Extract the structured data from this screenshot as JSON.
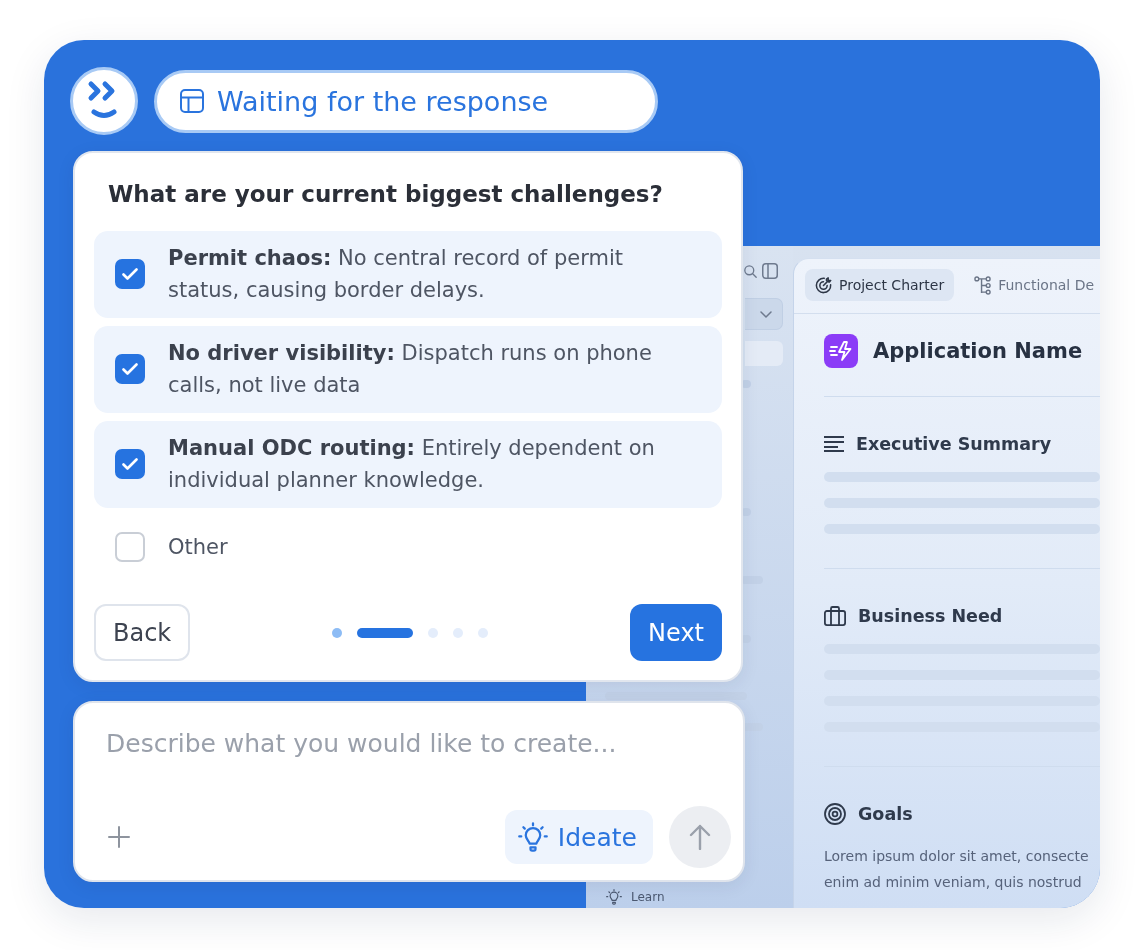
{
  "assistant": {
    "status": "Waiting for the response"
  },
  "question": {
    "title": "What are your current biggest challenges?",
    "options": [
      {
        "text": "**Permit chaos:** No central record of permit status, causing border delays.",
        "checked": true
      },
      {
        "text": "**No driver visibility:** Dispatch runs on phone calls, not live data",
        "checked": true
      },
      {
        "text": "**Manual ODC routing:** Entirely dependent on individual planner knowledge.",
        "checked": true
      },
      {
        "text": "Other",
        "checked": false
      }
    ],
    "steps": [
      {
        "done": true,
        "current": false
      },
      {
        "done": false,
        "current": true
      },
      {
        "done": false,
        "current": false
      },
      {
        "done": false,
        "current": false
      },
      {
        "done": false,
        "current": false
      }
    ],
    "back_button": "Back",
    "next_button": "Next"
  },
  "composer": {
    "placeholder": "Describe what you would like to create...",
    "ideate_button": "Ideate",
    "send": {
      "disabled": true
    }
  },
  "app": {
    "sidebar": {
      "footer": "Learn"
    },
    "tabs": [
      {
        "label": "Project Charter",
        "selected": true
      },
      {
        "label": "Functional De",
        "selected": false
      }
    ],
    "title": "Application Name",
    "sections": [
      {
        "kind": "summary",
        "heading": "Executive Summary"
      },
      {
        "kind": "need",
        "heading": "Business Need"
      },
      {
        "kind": "goals",
        "heading": "Goals",
        "lines": [
          "Lorem ipsum dolor sit amet, consecte",
          "enim ad minim veniam, quis nostrud"
        ]
      }
    ]
  }
}
